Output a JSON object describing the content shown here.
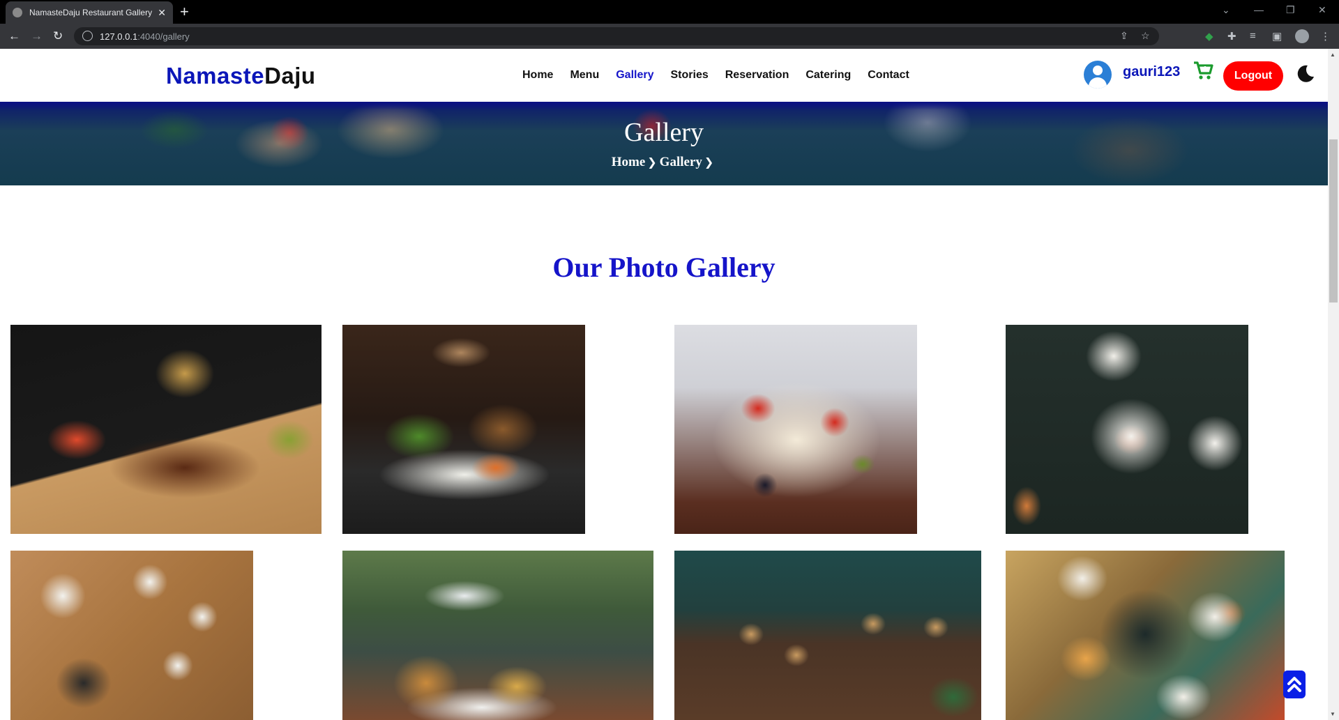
{
  "browser": {
    "tab_title": "NamasteDaju Restaurant Gallery",
    "url_host": "127.0.0.1",
    "url_rest": ":4040/gallery"
  },
  "header": {
    "logo_part1": "Namaste",
    "logo_part2": "Daju",
    "nav": [
      {
        "label": "Home",
        "active": false
      },
      {
        "label": "Menu",
        "active": false
      },
      {
        "label": "Gallery",
        "active": true
      },
      {
        "label": "Stories",
        "active": false
      },
      {
        "label": "Reservation",
        "active": false
      },
      {
        "label": "Catering",
        "active": false
      },
      {
        "label": "Contact",
        "active": false
      }
    ],
    "username": "gauri123",
    "logout_label": "Logout"
  },
  "hero": {
    "title": "Gallery",
    "crumb_home": "Home",
    "crumb_current": "Gallery"
  },
  "gallery": {
    "title": "Our Photo Gallery",
    "photos": [
      {
        "name": "ribs-platter-photo"
      },
      {
        "name": "steak-salad-photo"
      },
      {
        "name": "pasta-salad-photo"
      },
      {
        "name": "table-dishes-photo"
      },
      {
        "name": "korean-bibimbap-photo"
      },
      {
        "name": "burger-canal-photo"
      },
      {
        "name": "cafe-tables-aerial-photo"
      },
      {
        "name": "burgers-fries-table-photo"
      }
    ]
  },
  "colors": {
    "brand_blue": "#0b16b8",
    "active_nav": "#1514c9",
    "logout_red": "#ff0000",
    "cart_green": "#1b9b2d"
  }
}
